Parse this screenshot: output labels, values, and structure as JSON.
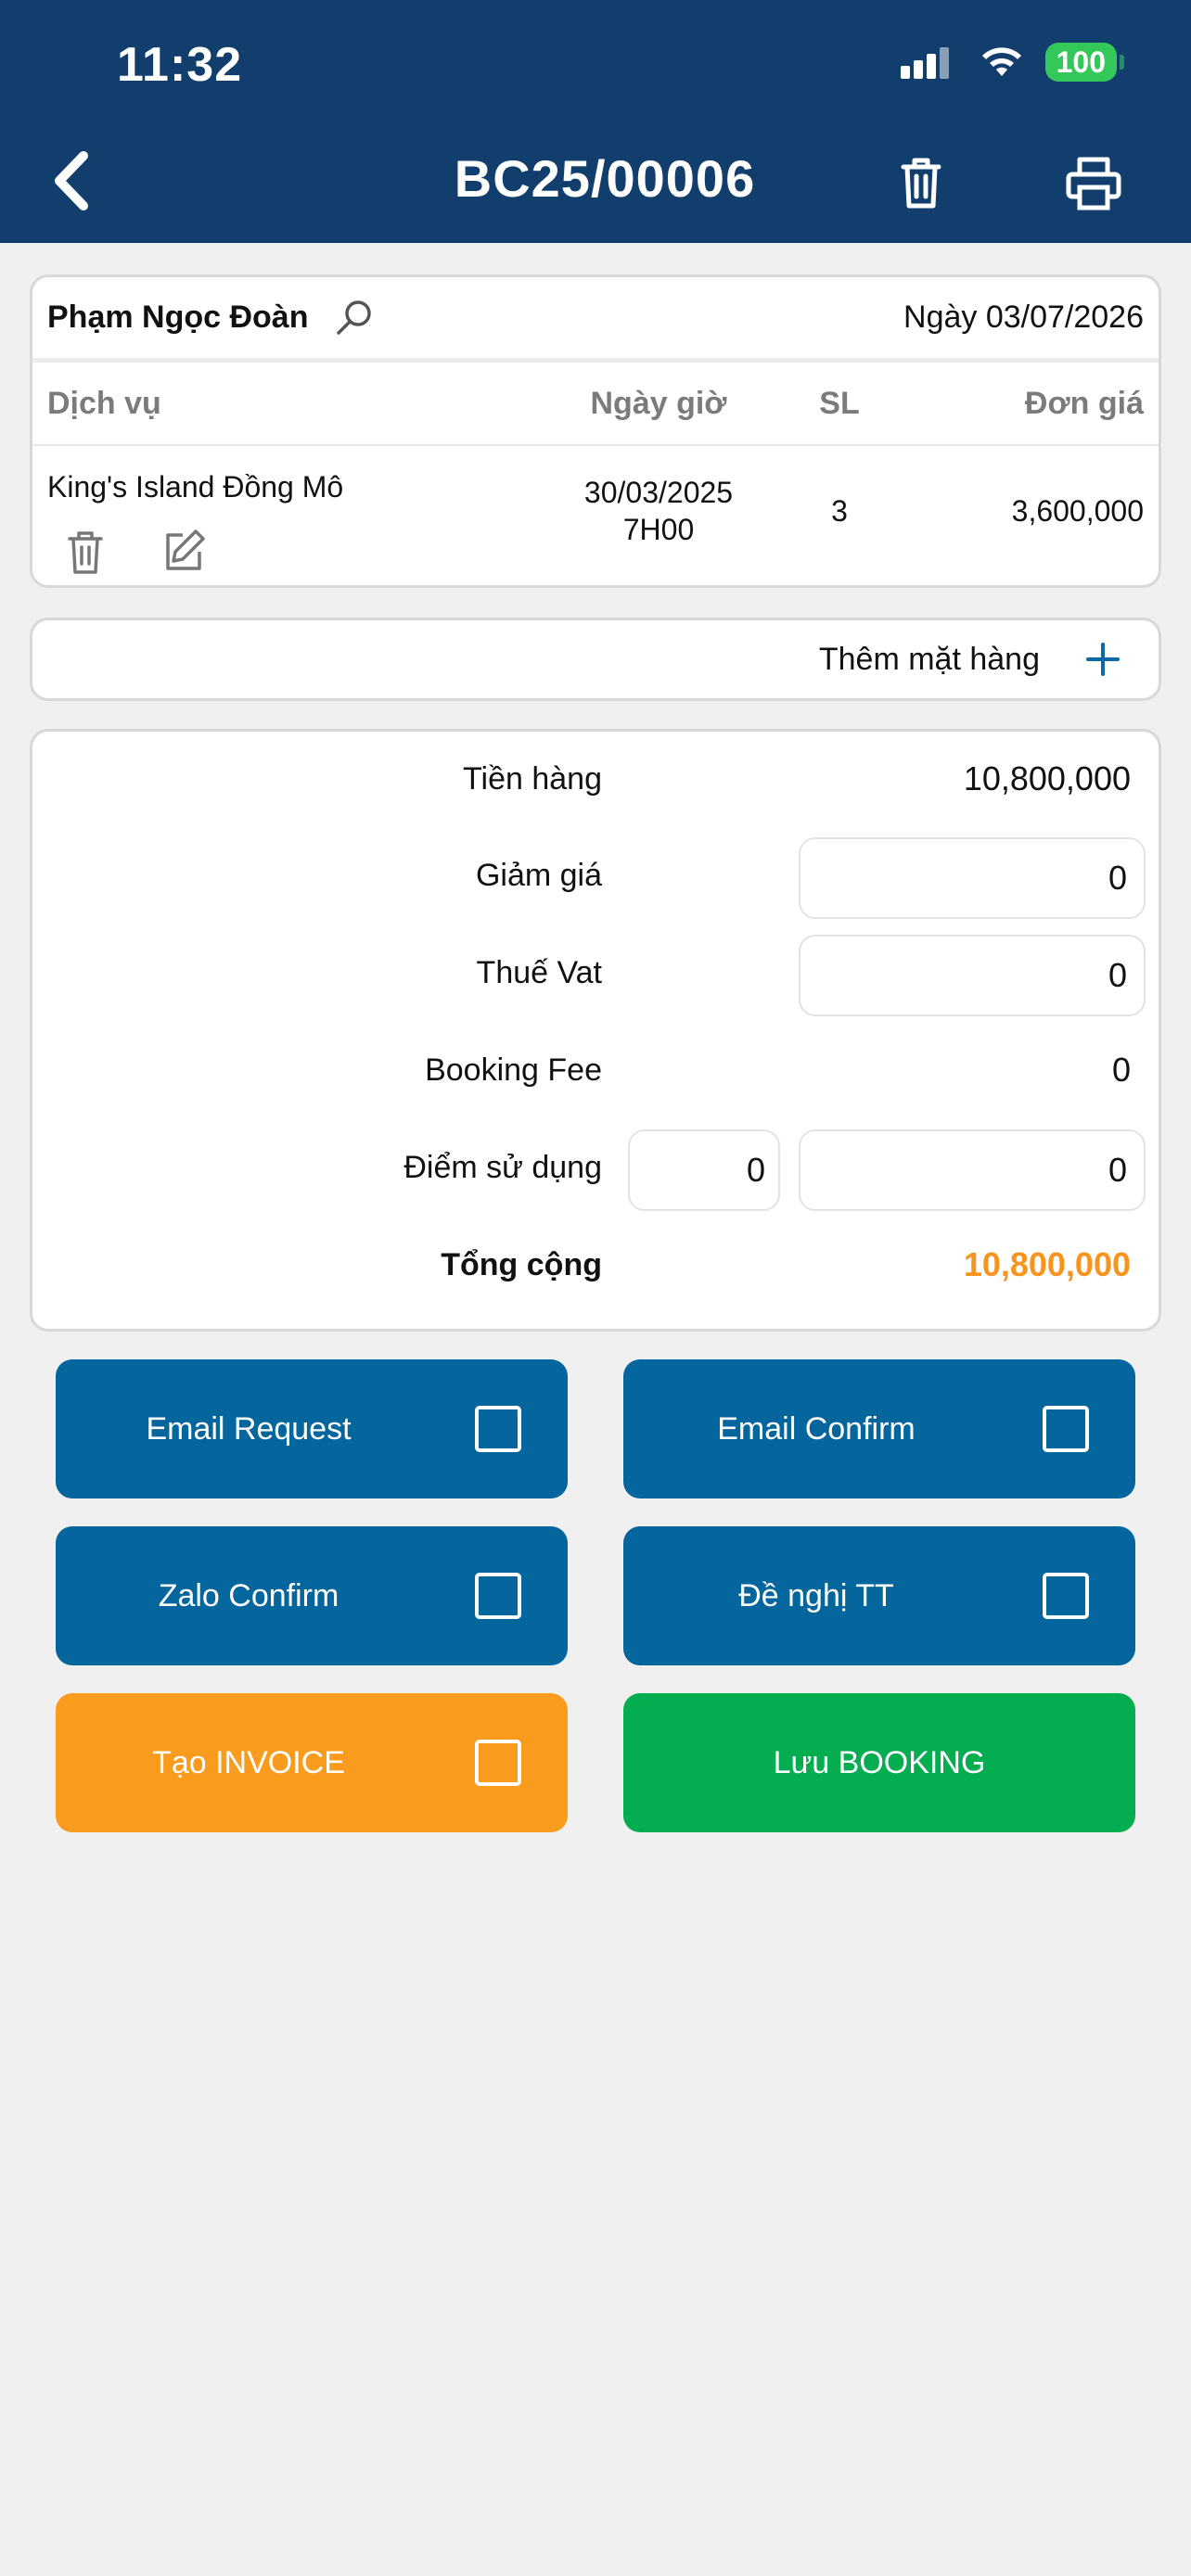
{
  "status_bar": {
    "time": "11:32",
    "battery": "100"
  },
  "header": {
    "title": "BC25/00006"
  },
  "customer": {
    "name": "Phạm Ngọc Đoàn",
    "date": "Ngày 03/07/2026"
  },
  "table": {
    "headers": {
      "service": "Dịch vụ",
      "datetime": "Ngày giờ",
      "qty": "SL",
      "price": "Đơn giá"
    },
    "rows": [
      {
        "service": "King's Island Đồng Mô",
        "date": "30/03/2025",
        "time": "7H00",
        "qty": "3",
        "price": "3,600,000"
      }
    ]
  },
  "add_item": {
    "label": "Thêm mặt hàng"
  },
  "totals": {
    "subtotal_label": "Tiền hàng",
    "subtotal": "10,800,000",
    "discount_label": "Giảm giá",
    "discount": "0",
    "vat_label": "Thuế Vat",
    "vat": "0",
    "booking_fee_label": "Booking Fee",
    "booking_fee": "0",
    "points_label": "Điểm sử dụng",
    "points": "0",
    "points_value": "0",
    "total_label": "Tổng cộng",
    "total": "10,800,000"
  },
  "actions": {
    "email_request": "Email Request",
    "email_confirm": "Email Confirm",
    "zalo_confirm": "Zalo Confirm",
    "payment_request": "Đề nghị TT",
    "create_invoice": "Tạo INVOICE",
    "save_booking": "Lưu BOOKING"
  },
  "colors": {
    "header_bg": "#123e6e",
    "primary_button": "#05659d",
    "invoice_button": "#f99c1e",
    "save_button": "#03ad50",
    "total_text": "#f7941d",
    "accent": "#0a6aa8"
  },
  "icons": [
    "back-chevron-icon",
    "trash-icon",
    "printer-icon",
    "search-icon",
    "edit-icon",
    "plus-icon",
    "checkbox-icon"
  ]
}
